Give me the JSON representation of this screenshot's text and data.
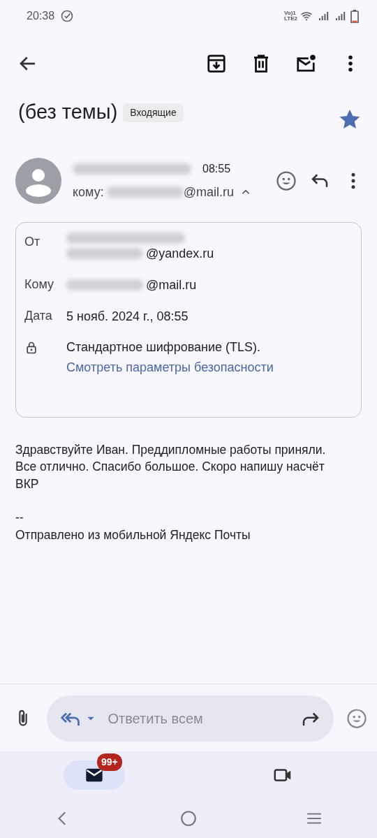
{
  "status_bar": {
    "time": "20:38",
    "sim_top": "Vo)1",
    "sim_bottom": "LTE2"
  },
  "subject": {
    "title": "(без темы)",
    "label": "Входящие",
    "starred": true
  },
  "message": {
    "sender": [
      {
        "kind": "redacted"
      }
    ],
    "time": "08:55",
    "to_prefix": "кому:",
    "to": [
      {
        "kind": "redacted"
      },
      {
        "kind": "text",
        "text": "@mail.ru"
      }
    ],
    "details_expanded": true
  },
  "details": [
    {
      "kind": "field",
      "label": "От",
      "lines": [
        [
          {
            "kind": "redacted"
          }
        ],
        [
          {
            "kind": "redacted"
          },
          {
            "kind": "text",
            "text": "@yandex.ru"
          }
        ]
      ]
    },
    {
      "kind": "field",
      "label": "Кому",
      "lines": [
        [
          {
            "kind": "redacted"
          },
          {
            "kind": "text",
            "text": "@mail.ru"
          }
        ]
      ]
    },
    {
      "kind": "field",
      "label": "Дата",
      "lines": [
        [
          {
            "kind": "text",
            "text": "5 нояб. 2024 г., 08:55"
          }
        ]
      ]
    },
    {
      "kind": "security",
      "text": "Стандартное шифрование (TLS).",
      "link": "Смотреть параметры безопасности"
    }
  ],
  "body": [
    {
      "kind": "paragraph",
      "text": "Здравствуйте Иван. Преддипломные работы приняли. Все отлично. Спасибо большое. Скоро напишу насчёт ВКР"
    },
    {
      "kind": "separator",
      "text": "--"
    },
    {
      "kind": "paragraph",
      "text": "Отправлено из мобильной Яндекс Почты"
    }
  ],
  "reply_bar": {
    "placeholder": "Ответить всем"
  },
  "bottom_nav": [
    {
      "kind": "mail",
      "selected": true,
      "badge": "99+"
    },
    {
      "kind": "meet",
      "selected": false
    }
  ]
}
